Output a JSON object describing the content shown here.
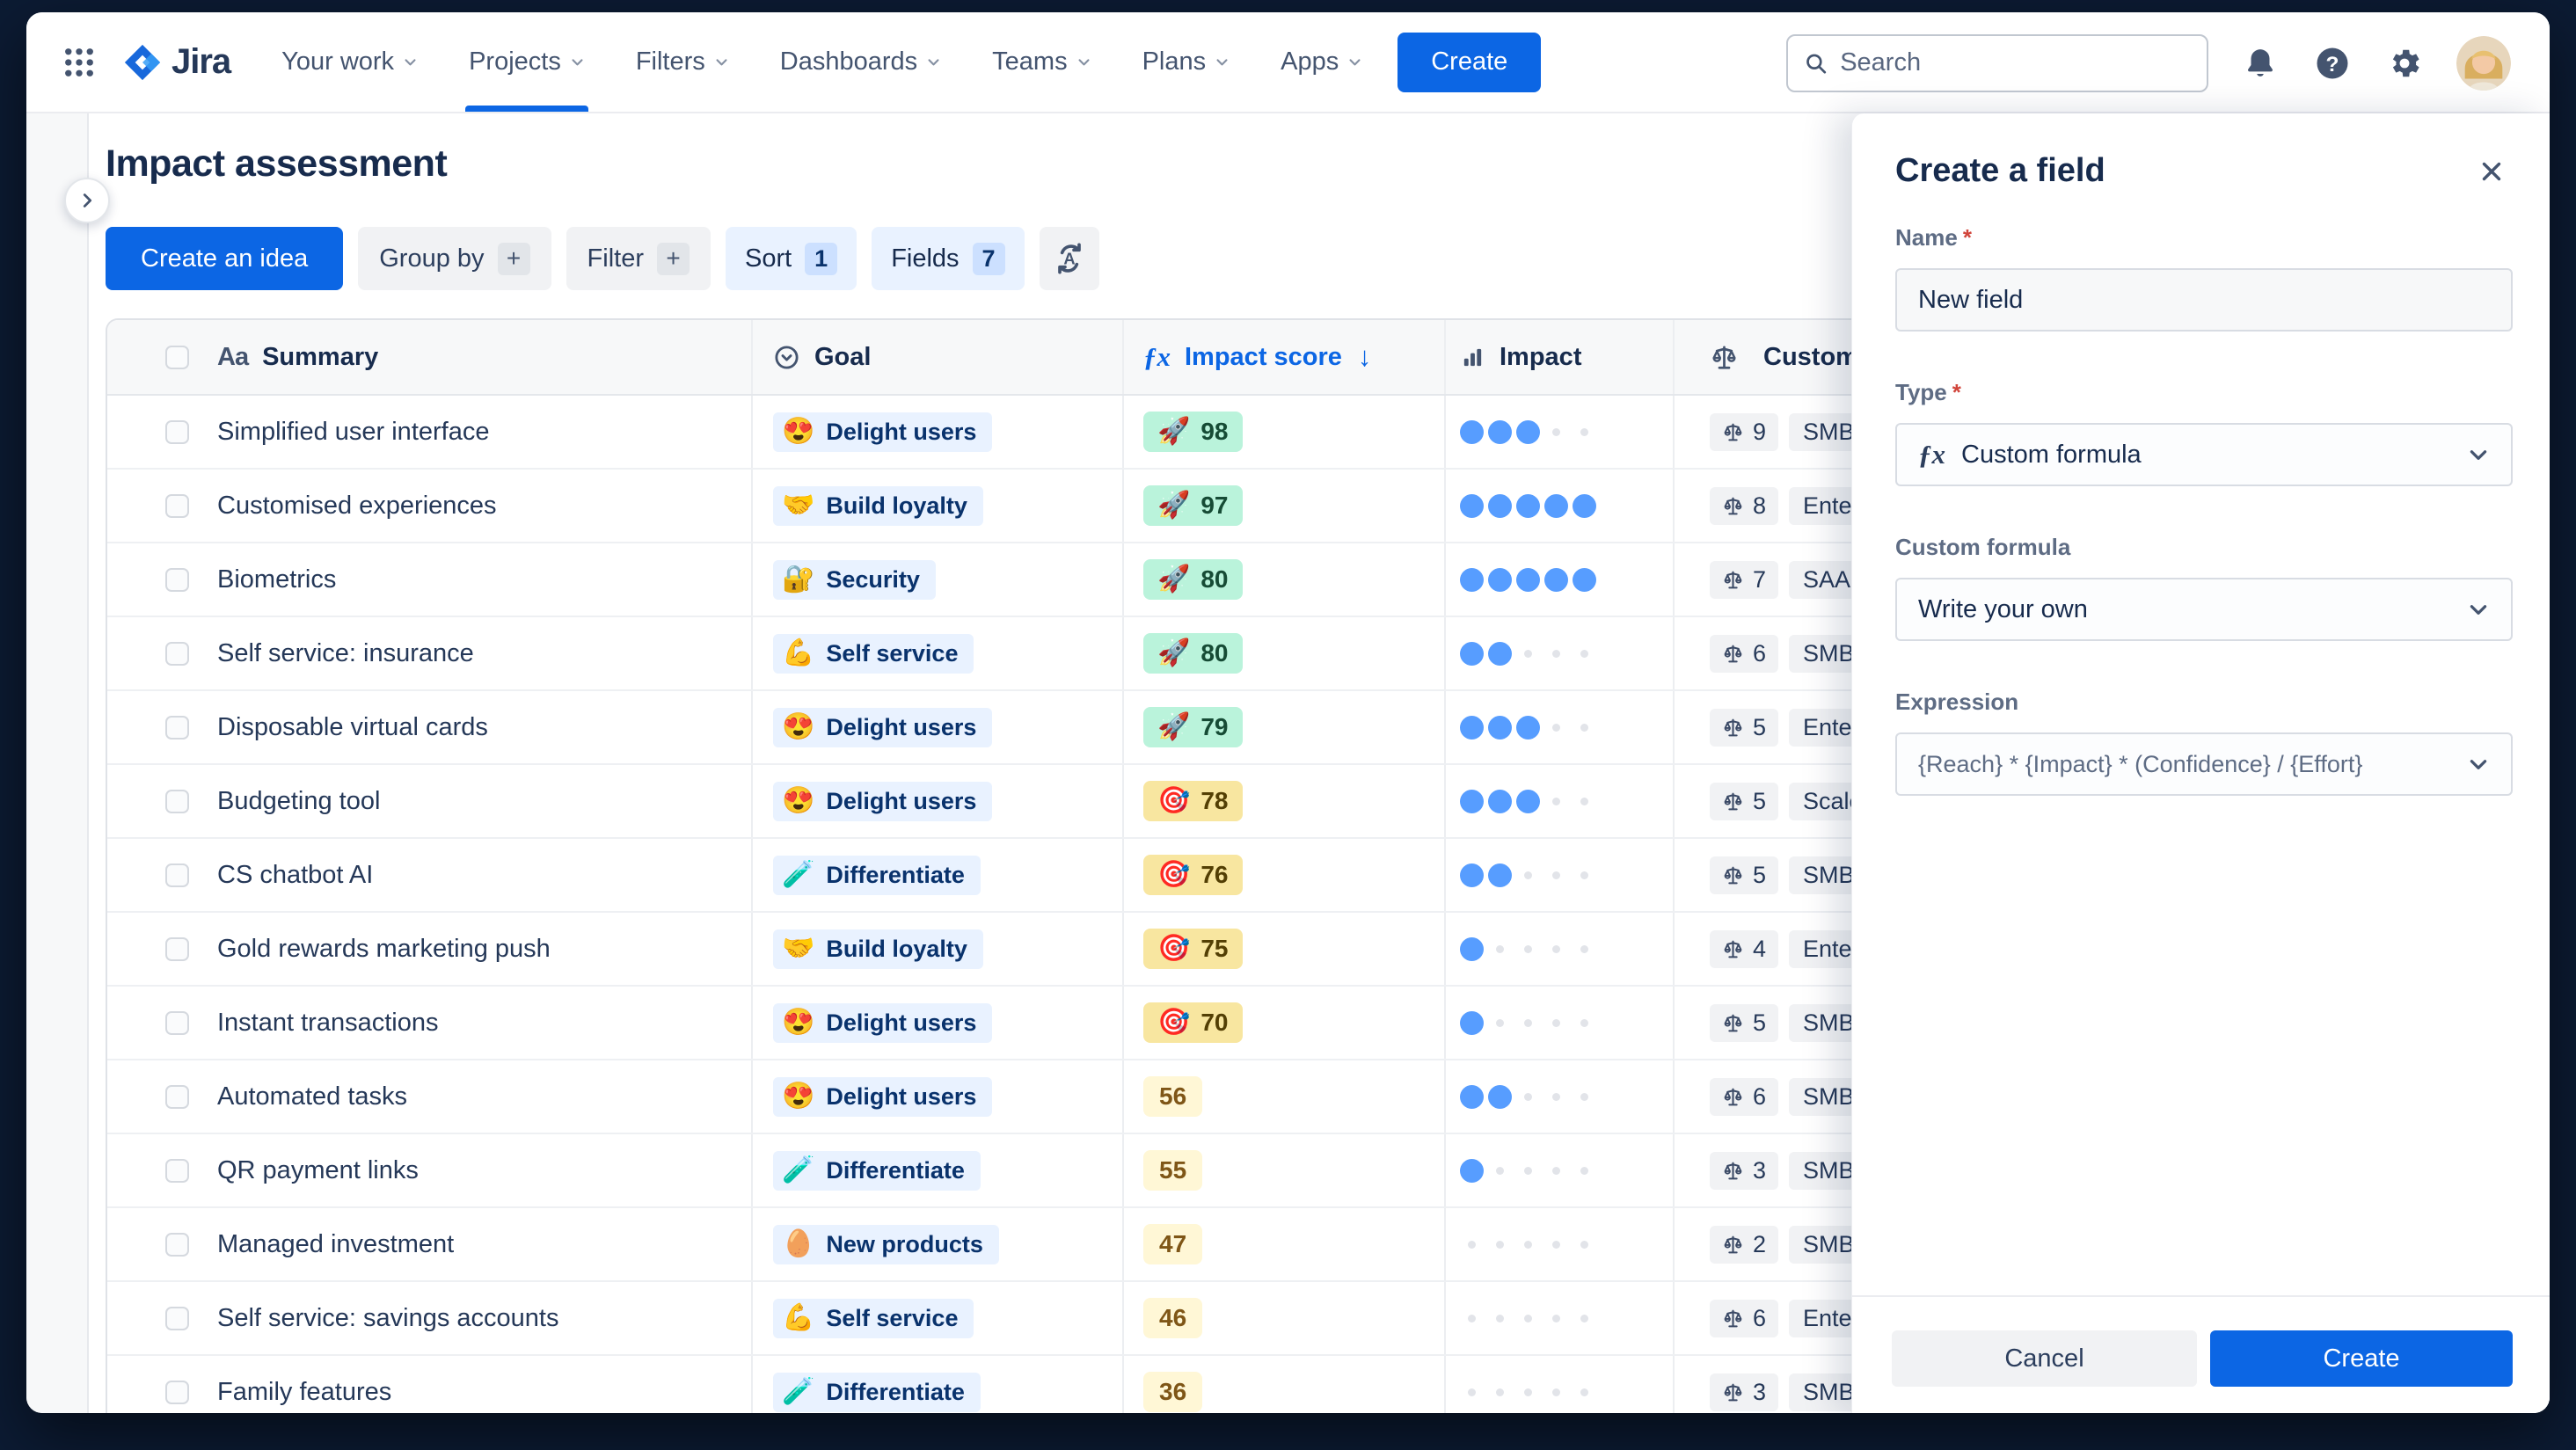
{
  "nav": {
    "logo_text": "Jira",
    "items": [
      "Your work",
      "Projects",
      "Filters",
      "Dashboards",
      "Teams",
      "Plans",
      "Apps"
    ],
    "active_item": "Projects",
    "create_label": "Create",
    "search_placeholder": "Search"
  },
  "page": {
    "title": "Impact assessment"
  },
  "toolbar": {
    "create_idea_label": "Create an idea",
    "group_by_label": "Group by",
    "group_by_badge": "+",
    "filter_label": "Filter",
    "filter_badge": "+",
    "sort_label": "Sort",
    "sort_count": "1",
    "fields_label": "Fields",
    "fields_count": "7"
  },
  "table": {
    "header": {
      "summary": "Summary",
      "goal": "Goal",
      "score": "Impact score",
      "impact": "Impact",
      "customer": "Customer"
    },
    "sorted_column": "Impact score",
    "sort_direction": "desc",
    "impact_dots_max": 5,
    "rows": [
      {
        "summary": "Simplified user interface",
        "goal_emoji": "😍",
        "goal": "Delight users",
        "score": "98",
        "score_emoji": "🚀",
        "score_tier": "green",
        "impact": 3,
        "customer_weight": "9",
        "customer_segment": "SMB"
      },
      {
        "summary": "Customised experiences",
        "goal_emoji": "🤝",
        "goal": "Build loyalty",
        "score": "97",
        "score_emoji": "🚀",
        "score_tier": "green",
        "impact": 5,
        "customer_weight": "8",
        "customer_segment": "Enter"
      },
      {
        "summary": "Biometrics",
        "goal_emoji": "🔐",
        "goal": "Security",
        "score": "80",
        "score_emoji": "🚀",
        "score_tier": "green",
        "impact": 5,
        "customer_weight": "7",
        "customer_segment": "SAAS"
      },
      {
        "summary": "Self service: insurance",
        "goal_emoji": "💪",
        "goal": "Self service",
        "score": "80",
        "score_emoji": "🚀",
        "score_tier": "green",
        "impact": 2,
        "customer_weight": "6",
        "customer_segment": "SMB"
      },
      {
        "summary": "Disposable virtual cards",
        "goal_emoji": "😍",
        "goal": "Delight users",
        "score": "79",
        "score_emoji": "🚀",
        "score_tier": "green",
        "impact": 3,
        "customer_weight": "5",
        "customer_segment": "Enterp"
      },
      {
        "summary": "Budgeting tool",
        "goal_emoji": "😍",
        "goal": "Delight users",
        "score": "78",
        "score_emoji": "🎯",
        "score_tier": "yellow",
        "impact": 3,
        "customer_weight": "5",
        "customer_segment": "Scale"
      },
      {
        "summary": "CS chatbot AI",
        "goal_emoji": "🧪",
        "goal": "Differentiate",
        "score": "76",
        "score_emoji": "🎯",
        "score_tier": "yellow",
        "impact": 2,
        "customer_weight": "5",
        "customer_segment": "SMB"
      },
      {
        "summary": "Gold rewards marketing push",
        "goal_emoji": "🤝",
        "goal": "Build loyalty",
        "score": "75",
        "score_emoji": "🎯",
        "score_tier": "yellow",
        "impact": 1,
        "customer_weight": "4",
        "customer_segment": "Enter"
      },
      {
        "summary": "Instant transactions",
        "goal_emoji": "😍",
        "goal": "Delight users",
        "score": "70",
        "score_emoji": "🎯",
        "score_tier": "yellow",
        "impact": 1,
        "customer_weight": "5",
        "customer_segment": "SMB"
      },
      {
        "summary": "Automated tasks",
        "goal_emoji": "😍",
        "goal": "Delight users",
        "score": "56",
        "score_emoji": "",
        "score_tier": "plain",
        "impact": 2,
        "customer_weight": "6",
        "customer_segment": "SMB"
      },
      {
        "summary": "QR payment links",
        "goal_emoji": "🧪",
        "goal": "Differentiate",
        "score": "55",
        "score_emoji": "",
        "score_tier": "plain",
        "impact": 1,
        "customer_weight": "3",
        "customer_segment": "SMB"
      },
      {
        "summary": "Managed investment",
        "goal_emoji": "🥚",
        "goal": "New products",
        "score": "47",
        "score_emoji": "",
        "score_tier": "plain",
        "impact": 0,
        "customer_weight": "2",
        "customer_segment": "SMB"
      },
      {
        "summary": "Self service: savings accounts",
        "goal_emoji": "💪",
        "goal": "Self service",
        "score": "46",
        "score_emoji": "",
        "score_tier": "plain",
        "impact": 0,
        "customer_weight": "6",
        "customer_segment": "Enter"
      },
      {
        "summary": "Family features",
        "goal_emoji": "🧪",
        "goal": "Differentiate",
        "score": "36",
        "score_emoji": "",
        "score_tier": "plain",
        "impact": 0,
        "customer_weight": "3",
        "customer_segment": "SMB"
      }
    ]
  },
  "panel": {
    "title": "Create a field",
    "name_label": "Name",
    "name_required": "*",
    "name_value": "New field",
    "type_label": "Type",
    "type_required": "*",
    "type_value": "Custom formula",
    "custom_formula_label": "Custom formula",
    "custom_formula_value": "Write your own",
    "expression_label": "Expression",
    "expression_value": "{Reach} * {Impact} * (Confidence} / {Effort}",
    "cancel_label": "Cancel",
    "create_label": "Create"
  },
  "colors": {
    "brand_blue": "#0C66E4",
    "dark_navy_frame": "#0C1B33",
    "green_pill_bg": "#BAF3DB",
    "yellow_pill_bg": "#F8E6A0",
    "cream_pill_bg": "#FFF7D6",
    "goal_pill_bg": "#E9F2FF",
    "impact_dot": "#579DFF"
  }
}
